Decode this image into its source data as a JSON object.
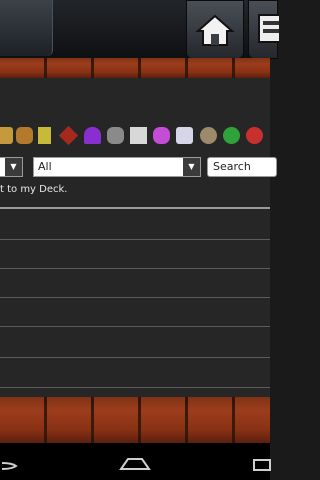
{
  "header": {
    "home_icon": "home-icon",
    "deck_icon": "deck-icon"
  },
  "icons": [
    {
      "name": "set-icon-1",
      "color": "#c49a3a"
    },
    {
      "name": "set-icon-2",
      "color": "#b27a2a"
    },
    {
      "name": "set-icon-3",
      "color": "#c8b93a"
    },
    {
      "name": "set-icon-4",
      "color": "#a5291d"
    },
    {
      "name": "set-icon-5",
      "color": "#8a2fcf"
    },
    {
      "name": "set-icon-6",
      "color": "#8a8a8a"
    },
    {
      "name": "set-icon-7",
      "color": "#d8d8d8"
    },
    {
      "name": "set-icon-8",
      "color": "#c44dd6"
    },
    {
      "name": "set-icon-9",
      "color": "#d6d6e8"
    },
    {
      "name": "set-icon-10",
      "color": "#9c8a6a"
    },
    {
      "name": "set-icon-11",
      "color": "#2fa33a"
    },
    {
      "name": "set-icon-12",
      "color": "#c83030"
    }
  ],
  "filters": {
    "second_select_value": "All",
    "search_placeholder": "Search"
  },
  "hint": "t to my Deck.",
  "nav": {
    "back_icon": "back-icon",
    "home_icon": "nav-home-icon",
    "recents_icon": "recents-icon"
  }
}
